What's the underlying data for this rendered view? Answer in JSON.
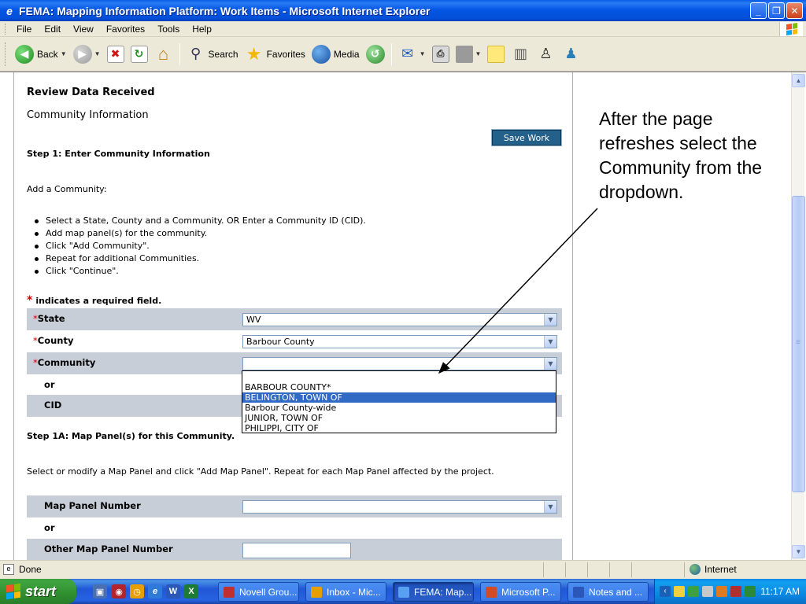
{
  "window": {
    "title": "FEMA: Mapping Information Platform: Work Items - Microsoft Internet Explorer",
    "minimize": "_",
    "maximize": "❐",
    "close": "✕"
  },
  "menu": {
    "items": [
      "File",
      "Edit",
      "View",
      "Favorites",
      "Tools",
      "Help"
    ]
  },
  "toolbar": {
    "back": "Back",
    "search": "Search",
    "favorites": "Favorites",
    "media": "Media"
  },
  "page": {
    "heading": "Review Data Received",
    "subheading": "Community Information",
    "save_label": "Save Work",
    "step1_title": "Step 1: Enter Community Information",
    "add_community": "Add a Community:",
    "instructions": [
      "Select a State, County and a Community. OR Enter a Community ID (CID).",
      "Add map panel(s) for the community.",
      "Click \"Add Community\".",
      "Repeat for additional Communities.",
      "Click \"Continue\"."
    ],
    "required_mark": "*",
    "required_note": "indicates a required field.",
    "fields": {
      "state_label": "State",
      "state_value": "WV",
      "county_label": "County",
      "county_value": "Barbour County",
      "community_label": "Community",
      "community_value": "",
      "or_label": "or",
      "cid_label": "CID"
    },
    "community_options": [
      "",
      "BARBOUR COUNTY*",
      "BELINGTON, TOWN OF",
      "Barbour County-wide",
      "JUNIOR, TOWN OF",
      "PHILIPPI, CITY OF"
    ],
    "community_highlighted": "BELINGTON, TOWN OF",
    "step1a_title": "Step 1A: Map Panel(s) for this Community.",
    "step1a_instruction": "Select or modify a Map Panel and click \"Add Map Panel\". Repeat for each Map Panel affected by the project.",
    "map_panel_label": "Map Panel Number",
    "map_panel_value": "",
    "or_label2": "or",
    "other_panel_label": "Other Map Panel Number",
    "other_panel_value": ""
  },
  "annotation": {
    "text": "After the page refreshes select the Community from the dropdown."
  },
  "status": {
    "left": "Done",
    "zone": "Internet"
  },
  "taskbar": {
    "start": "start",
    "tasks": [
      "Novell Grou...",
      "Inbox - Mic...",
      "FEMA: Map...",
      "Microsoft P...",
      "Notes and ..."
    ],
    "active_task": "FEMA: Map...",
    "clock": "11:17 AM"
  },
  "colors": {
    "field_row_bg": "#c8ced8",
    "save_button": "#23608a",
    "required": "#cc0000",
    "selected_option": "#316ac5",
    "title_bar": "#0556e4",
    "start_button": "#3fa53f"
  }
}
